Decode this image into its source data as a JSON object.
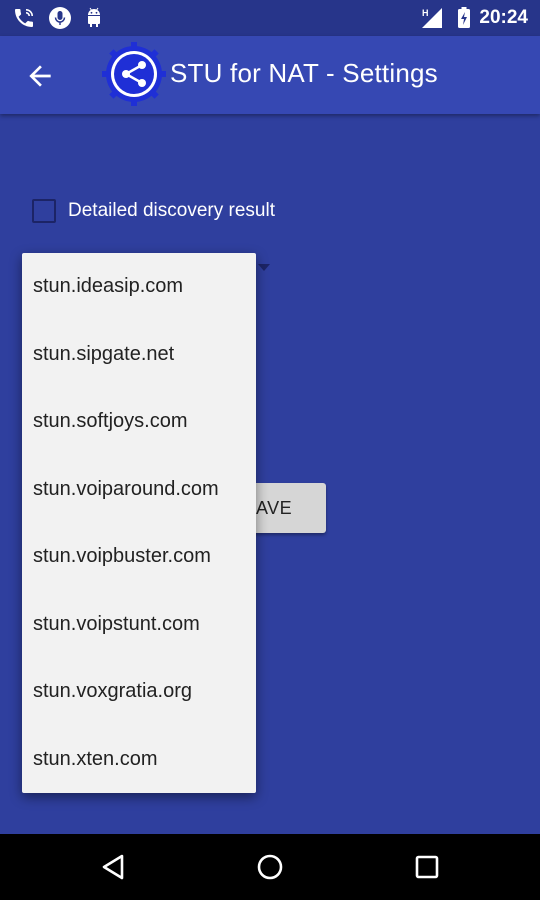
{
  "status_bar": {
    "time": "20:24",
    "icons": [
      "phone-wifi-icon",
      "mic-icon",
      "android-icon",
      "signal-icon",
      "battery-charging-icon"
    ],
    "network_type": "H"
  },
  "app_bar": {
    "title": "STU for NAT - Settings",
    "back_icon": "arrow-left-icon",
    "logo_icon": "share-gear-icon"
  },
  "settings": {
    "detailed_discovery_label": "Detailed discovery result",
    "detailed_discovery_checked": false,
    "save_label": "SAVE",
    "save_visible_label": "AVE"
  },
  "dropdown": {
    "items": [
      "stun.ideasip.com",
      "stun.sipgate.net",
      "stun.softjoys.com",
      "stun.voiparound.com",
      "stun.voipbuster.com",
      "stun.voipstunt.com",
      "stun.voxgratia.org",
      "stun.xten.com"
    ]
  },
  "nav_bar": {
    "icons": [
      "back-triangle-icon",
      "home-circle-icon",
      "recents-square-icon"
    ]
  },
  "colors": {
    "background": "#2f3f9e",
    "app_bar": "#3648b3",
    "status_bar": "#27358a",
    "dropdown_bg": "#f2f2f2",
    "button_bg": "#d6d6d6"
  }
}
